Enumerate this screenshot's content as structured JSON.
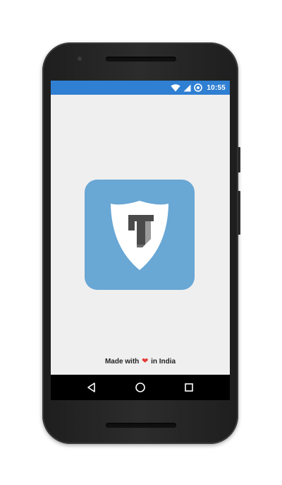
{
  "status_bar": {
    "time": "10:55",
    "icons": [
      "wifi-icon",
      "signal-icon",
      "data-saver-icon"
    ],
    "color": "#2f7fd2"
  },
  "splash": {
    "logo": "shield-t-logo",
    "icon_background": "#69a7d5",
    "footer_prefix": "Made with",
    "footer_icon": "heart-icon",
    "footer_suffix": "in India",
    "heart_color": "#e53935"
  },
  "nav_bar": {
    "buttons": [
      "back-icon",
      "home-icon",
      "recents-icon"
    ]
  }
}
